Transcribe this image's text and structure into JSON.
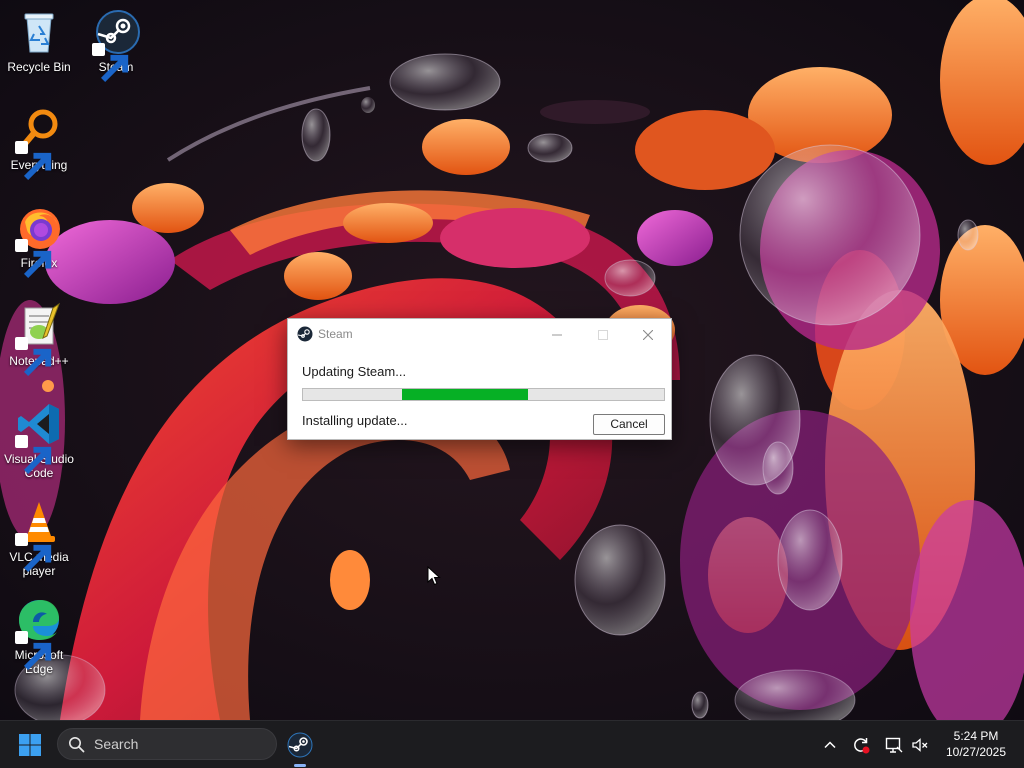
{
  "desktop": {
    "icons": [
      {
        "label": "Recycle Bin"
      },
      {
        "label": "Steam"
      },
      {
        "label": "Everything"
      },
      {
        "label": "Firefox"
      },
      {
        "label": "Notepad++"
      },
      {
        "label": "Visual Studio Code"
      },
      {
        "label": "VLC media player"
      },
      {
        "label": "Microsoft Edge"
      }
    ]
  },
  "dialog": {
    "title": "Steam",
    "status": "Updating Steam...",
    "detail": "Installing update...",
    "cancel_label": "Cancel",
    "progress": {
      "start_fraction": 0.275,
      "end_fraction": 0.625
    },
    "progress_color": "#06b025"
  },
  "taskbar": {
    "search_placeholder": "Search",
    "time": "5:24 PM",
    "date": "10/27/2025"
  },
  "colors": {
    "taskbar_bg": "#1c1c1f",
    "accent": "#0078d4"
  }
}
